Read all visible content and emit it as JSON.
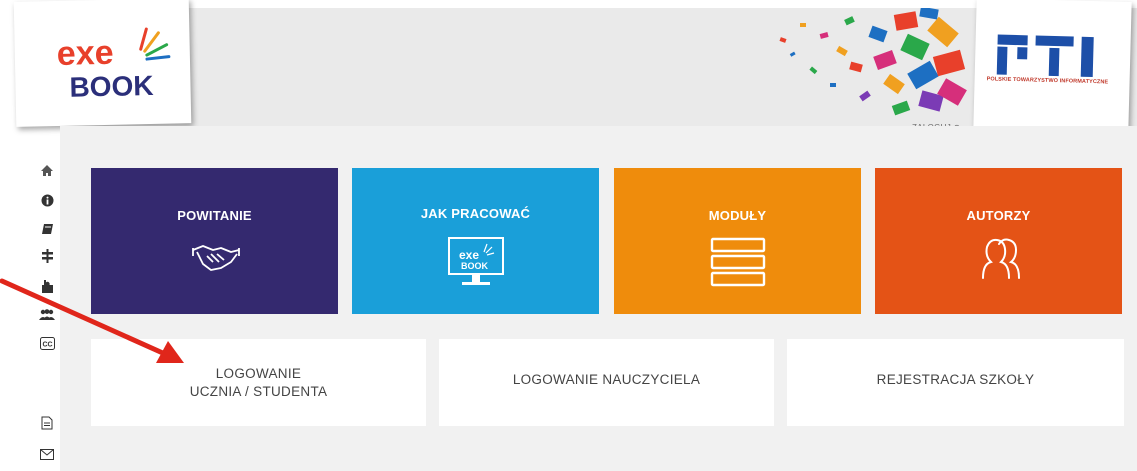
{
  "header": {
    "left_logo_name": "exe-book-logo",
    "right_logo_name": "pti-logo",
    "pti_subtitle": "POLSKIE TOWARZYSTWO INFORMATYCZNE",
    "login_link": "ZALOGUJ"
  },
  "sidebar": {
    "items": [
      {
        "icon": "home-icon",
        "glyph": "⌂"
      },
      {
        "icon": "info-icon",
        "glyph": "ℹ"
      },
      {
        "icon": "book-icon",
        "glyph": "▰"
      },
      {
        "icon": "signpost-icon",
        "glyph": "‡"
      },
      {
        "icon": "puzzle-icon",
        "glyph": "✚"
      },
      {
        "icon": "users-icon",
        "glyph": "☗"
      },
      {
        "icon": "cc-icon",
        "glyph": "CC"
      },
      {
        "icon": "document-icon",
        "glyph": "▤"
      },
      {
        "icon": "envelope-icon",
        "glyph": "✉"
      }
    ]
  },
  "tiles": [
    {
      "label": "POWITANIE",
      "color": "#34296f",
      "icon": "handshake-icon"
    },
    {
      "label": "JAK PRACOWAĆ",
      "color": "#1a9fd9",
      "icon": "monitor-icon"
    },
    {
      "label": "MODUŁY",
      "color": "#ef8c0c",
      "icon": "stack-icon"
    },
    {
      "label": "AUTORZY",
      "color": "#e45316",
      "icon": "people-icon"
    }
  ],
  "buttons": {
    "student_line1": "LOGOWANIE",
    "student_line2": "UCZNIA / STUDENTA",
    "teacher": "LOGOWANIE NAUCZYCIELA",
    "school": "REJESTRACJA SZKOŁY"
  },
  "colors": {
    "header_bg": "#eaeaea",
    "content_bg": "#f1f1f1",
    "arrow": "#e0261b"
  }
}
